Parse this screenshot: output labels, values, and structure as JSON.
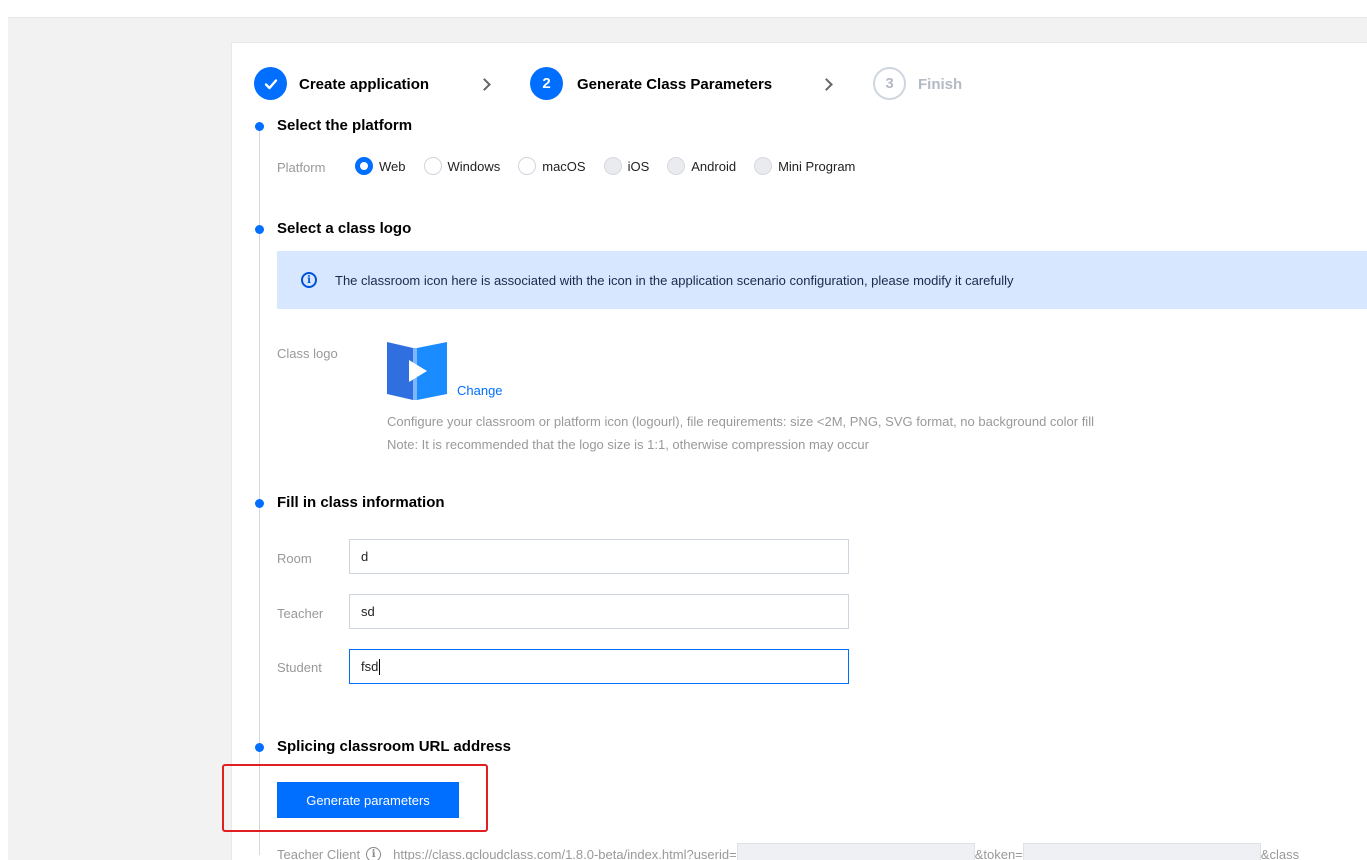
{
  "steps": [
    {
      "number": "",
      "label": "Create application",
      "state": "done"
    },
    {
      "number": "2",
      "label": "Generate Class Parameters",
      "state": "active"
    },
    {
      "number": "3",
      "label": "Finish",
      "state": "todo"
    }
  ],
  "platform_section": {
    "title": "Select the platform",
    "label": "Platform",
    "options": [
      "Web",
      "Windows",
      "macOS",
      "iOS",
      "Android",
      "Mini Program"
    ],
    "selected": "Web"
  },
  "logo_section": {
    "title": "Select a class logo",
    "notice": "The classroom icon here is associated with the icon in the application scenario configuration, please modify it carefully",
    "label": "Class logo",
    "change_link": "Change",
    "hint1": "Configure your classroom or platform icon (logourl), file requirements: size <2M, PNG, SVG format, no background color fill",
    "hint2": "Note: It is recommended that the logo size is 1:1, otherwise compression may occur"
  },
  "class_info_section": {
    "title": "Fill in class information",
    "fields": [
      {
        "label": "Room",
        "value": "d"
      },
      {
        "label": "Teacher",
        "value": "sd"
      },
      {
        "label": "Student",
        "value": "fsd"
      }
    ]
  },
  "url_section": {
    "title": "Splicing classroom URL address",
    "button_label": "Generate parameters",
    "teacher_client_label": "Teacher Client",
    "url_prefix": "https://class.qcloudclass.com/1.8.0-beta/index.html?userid=",
    "token_param": "&token=",
    "class_param": "&class"
  },
  "colors": {
    "accent": "#006eff",
    "notice_bg": "#d6e7ff",
    "highlight": "#e02020"
  }
}
